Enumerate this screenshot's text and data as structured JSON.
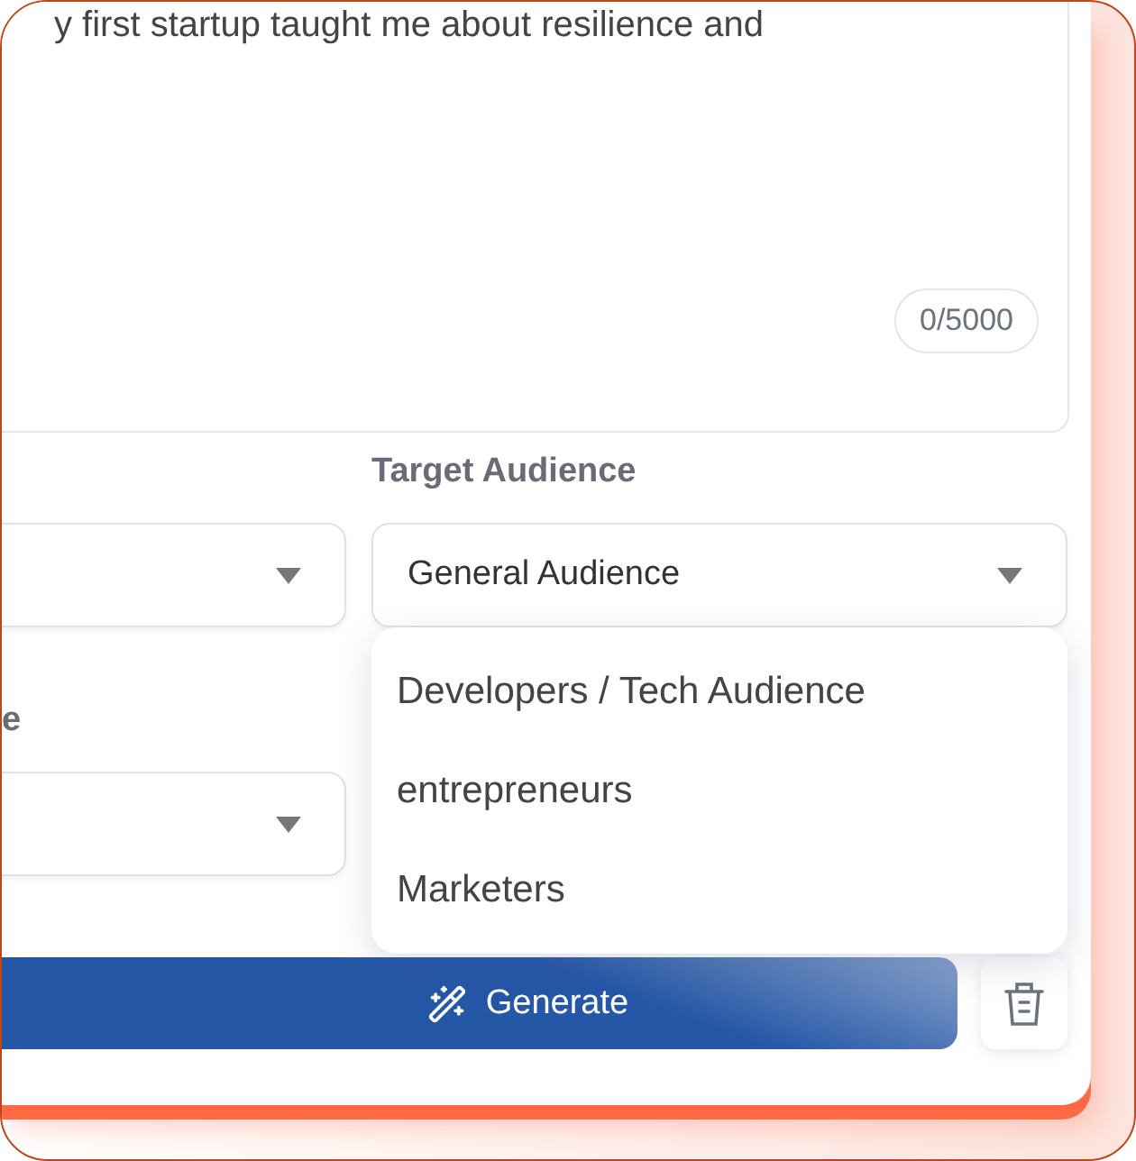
{
  "editor": {
    "text": "y first startup taught me about resilience and",
    "counter": "0/5000"
  },
  "column_1": {
    "label": "e"
  },
  "target_audience": {
    "label": "Target Audience",
    "value": "General Audience",
    "expanded": true,
    "options": [
      "Developers / Tech Audience",
      "entrepreneurs",
      "Marketers"
    ]
  },
  "actions": {
    "generate": "Generate"
  }
}
